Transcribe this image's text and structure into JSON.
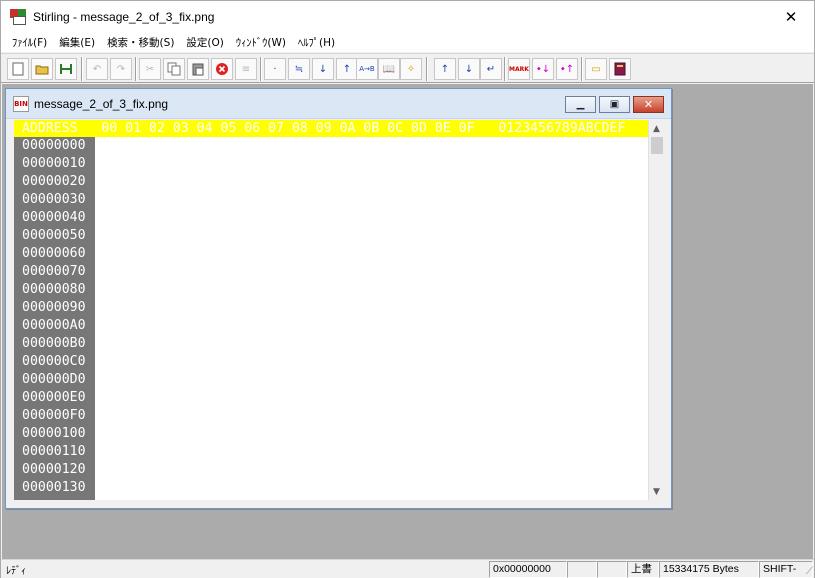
{
  "window": {
    "title": "Stirling - message_2_of_3_fix.png",
    "close_glyph": "✕"
  },
  "menu": [
    {
      "label": "ﾌｧｲﾙ(F)"
    },
    {
      "label": "編集(E)"
    },
    {
      "label": "検索・移動(S)"
    },
    {
      "label": "設定(O)"
    },
    {
      "label": "ｳｨﾝﾄﾞｳ(W)"
    },
    {
      "label": "ﾍﾙﾌﾟ(H)"
    }
  ],
  "toolbar": {
    "mark_label": "MARK"
  },
  "document": {
    "title": "message_2_of_3_fix.png",
    "icon_label": "BIN",
    "minimize_glyph": "▁",
    "restore_glyph": "▣",
    "close_glyph": "✕"
  },
  "hex": {
    "header": "ADDRESS   00 01 02 03 04 05 06 07 08 09 0A 0B 0C 0D 0E 0F   0123456789ABCDEF",
    "addresses": [
      "00000000",
      "00000010",
      "00000020",
      "00000030",
      "00000040",
      "00000050",
      "00000060",
      "00000070",
      "00000080",
      "00000090",
      "000000A0",
      "000000B0",
      "000000C0",
      "000000D0",
      "000000E0",
      "000000F0",
      "00000100",
      "00000110",
      "00000120",
      "00000130"
    ],
    "scroll_up": "▲",
    "scroll_down": "▼"
  },
  "status": {
    "message": "ﾚﾃﾞｨ",
    "address": "0x00000000",
    "cell2": "",
    "cell3": "",
    "mode": "上書",
    "size": "15334175 Bytes",
    "shift": "SHIFT-"
  },
  "colors": {
    "header_bg": "#ffff00",
    "address_bg": "#777777",
    "mdi_bg": "#ababab"
  }
}
